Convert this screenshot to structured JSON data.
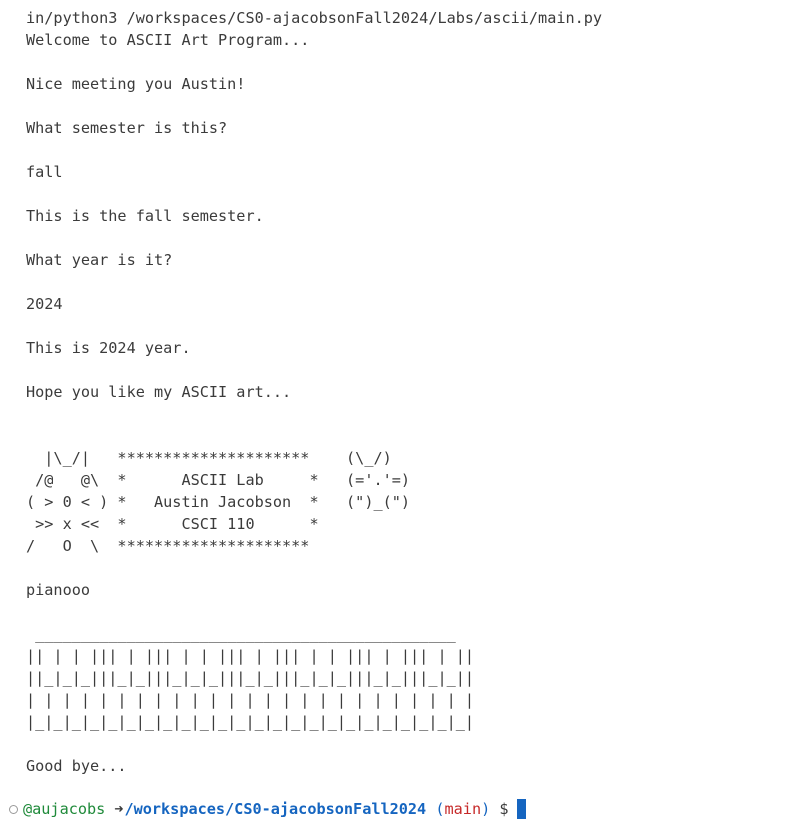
{
  "terminal": {
    "output": "in/python3 /workspaces/CS0-ajacobsonFall2024/Labs/ascii/main.py\nWelcome to ASCII Art Program...\n\nNice meeting you Austin!\n\nWhat semester is this?\n\nfall\n\nThis is the fall semester.\n\nWhat year is it?\n\n2024\n\nThis is 2024 year.\n\nHope you like my ASCII art...\n\n\n  |\\_/|   *********************    (\\_/)\n /@   @\\  *      ASCII Lab     *   (='.'=)\n( > 0 < ) *   Austin Jacobson  *   (\")_(\")\n >> x <<  *      CSCI 110      *\n/   O  \\  *********************\n\npianooo\n\n ______________________________________________\n|| | | ||| | ||| | | ||| | ||| | | ||| | ||| | ||\n||_|_|_|||_|_|||_|_|_|||_|_|||_|_|_|||_|_|||_|_||\n| | | | | | | | | | | | | | | | | | | | | | | | |\n|_|_|_|_|_|_|_|_|_|_|_|_|_|_|_|_|_|_|_|_|_|_|_|_|\n\nGood bye...",
    "prompt": {
      "user": "@aujacobs",
      "arrow": "➜",
      "path": "/workspaces/CS0-ajacobsonFall2024",
      "branch_open": "(",
      "branch": "main",
      "branch_close": ")",
      "symbol": "$"
    },
    "colors": {
      "user": "#1f8a3a",
      "path": "#1565c0",
      "branch": "#c62828",
      "cursor": "#1565c0",
      "text": "#3b3b3b"
    }
  }
}
